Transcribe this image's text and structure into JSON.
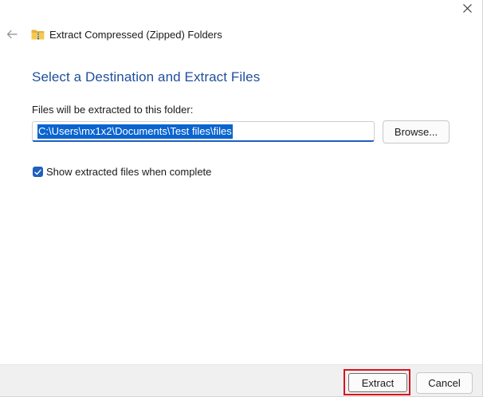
{
  "window": {
    "title": "Extract Compressed (Zipped) Folders",
    "close_icon": "close-icon",
    "back_icon": "back-arrow-icon",
    "folder_icon": "zip-folder-icon"
  },
  "main": {
    "heading": "Select a Destination and Extract Files",
    "destination_label": "Files will be extracted to this folder:",
    "destination_value": "C:\\Users\\mx1x2\\Documents\\Test files\\files",
    "destination_selected": true,
    "browse_label": "Browse...",
    "show_files_checked": true,
    "show_files_label": "Show extracted files when complete"
  },
  "footer": {
    "extract_label": "Extract",
    "cancel_label": "Cancel"
  },
  "colors": {
    "heading": "#1f4e9c",
    "selection": "#0a64d0",
    "checkbox": "#1f5fbf",
    "highlight_box": "#d9121e",
    "footer_bg": "#f0f0f0"
  }
}
